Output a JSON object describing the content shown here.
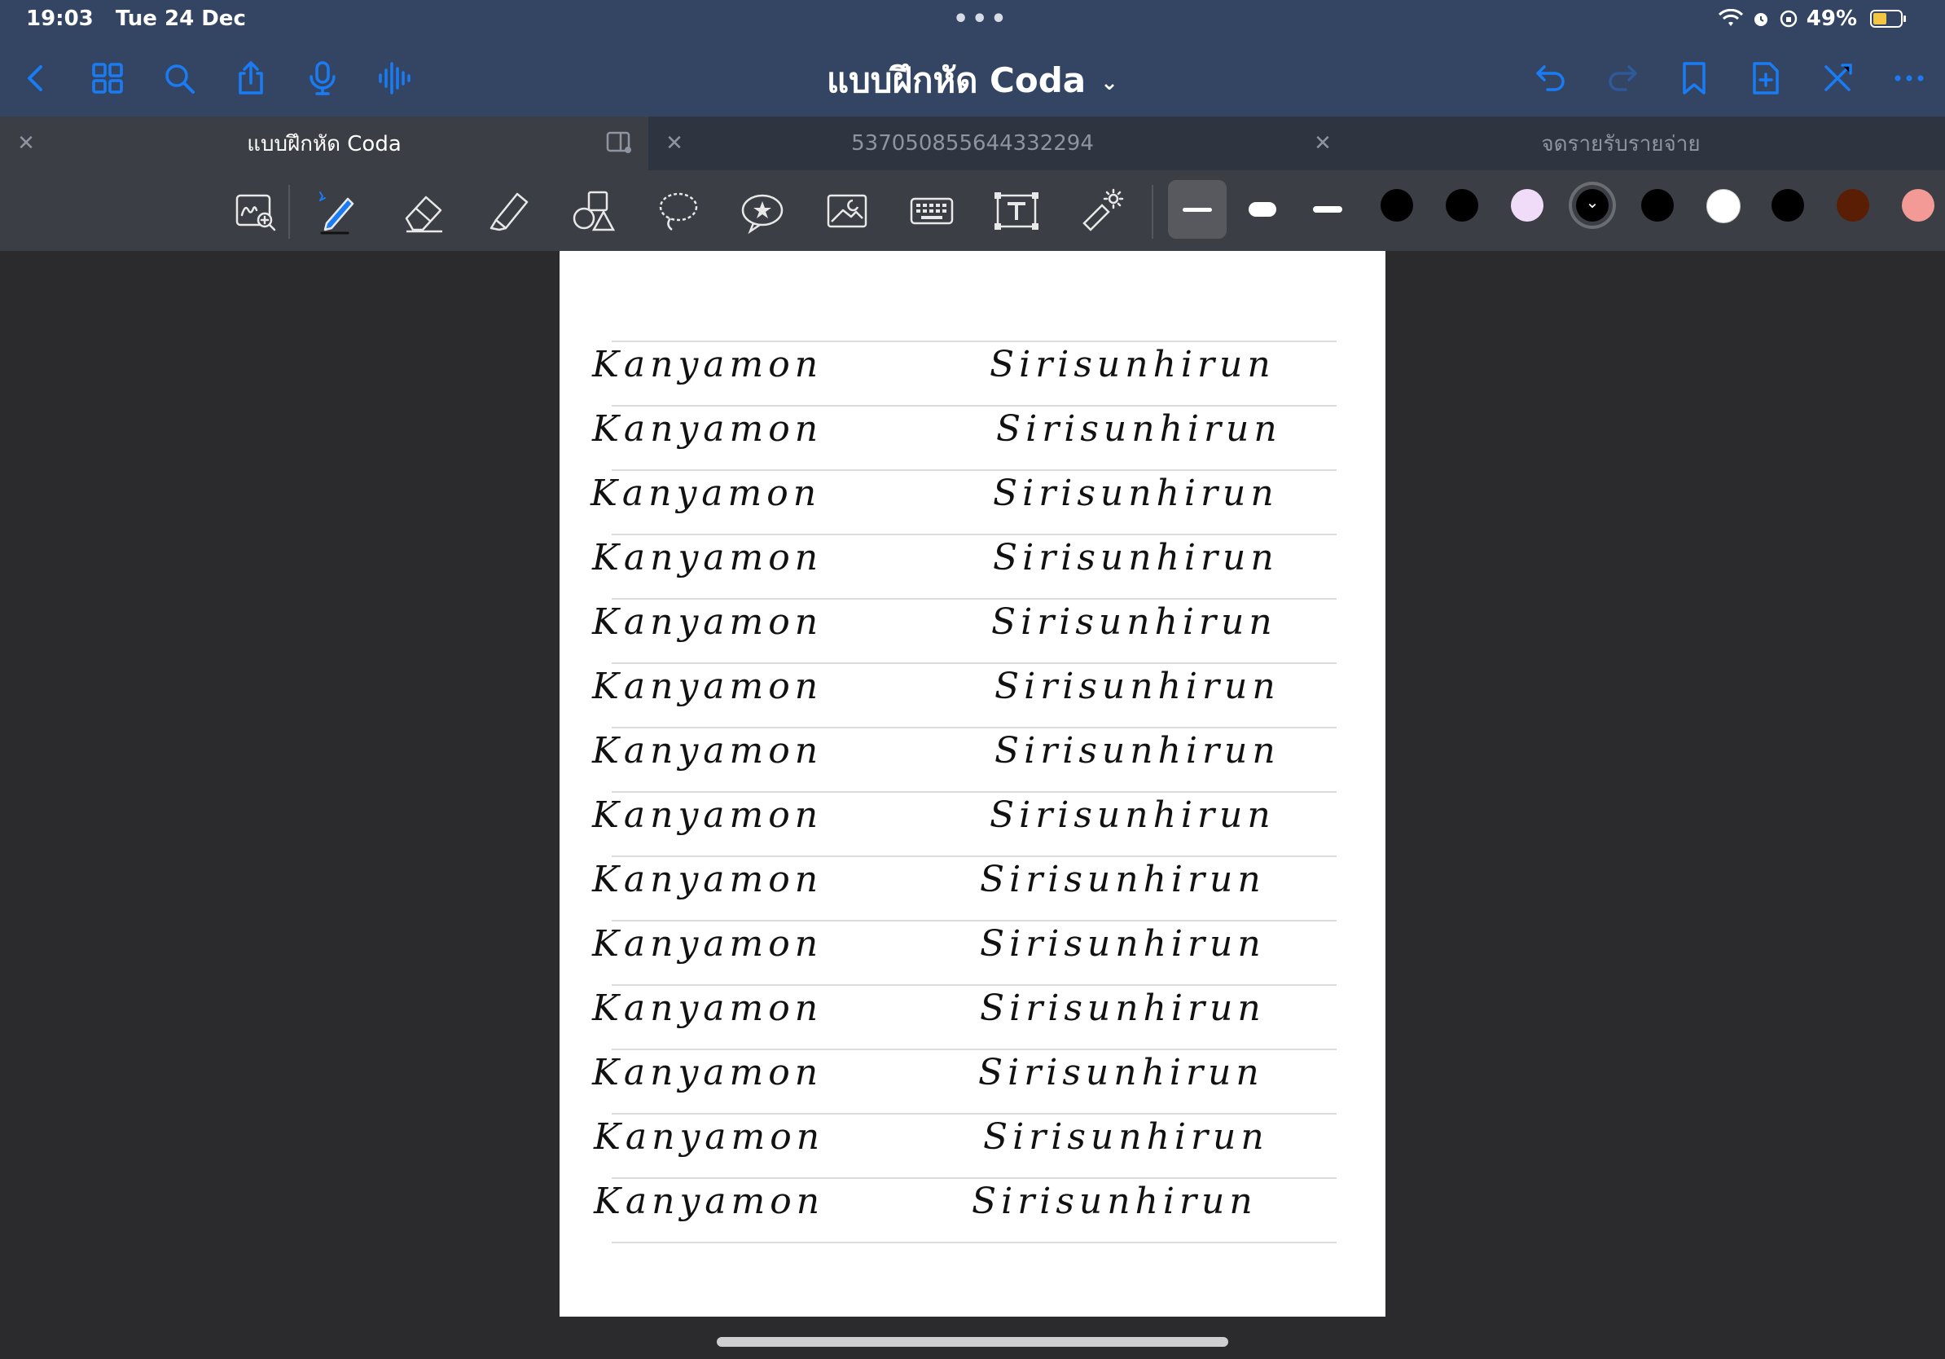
{
  "status": {
    "time": "19:03",
    "date": "Tue 24 Dec",
    "battery": "49%",
    "battery_level": 0.49
  },
  "nav": {
    "title": "แบบฝึกหัด Coda",
    "left_icons": [
      "back-chevron-icon",
      "grid-icon",
      "search-icon",
      "share-icon",
      "microphone-icon",
      "audio-waveform-icon"
    ],
    "right_icons": [
      "undo-icon",
      "redo-icon",
      "bookmark-icon",
      "add-page-icon",
      "close-x-icon",
      "more-icon"
    ]
  },
  "tabs": [
    {
      "label": "แบบฝึกหัด Coda",
      "active": true
    },
    {
      "label": "537050855644332294",
      "active": false
    },
    {
      "label": "จดรายรับรายจ่าย",
      "active": false
    }
  ],
  "toolbar": {
    "tools": [
      "zoom-handwriting-icon",
      "pen-icon",
      "eraser-icon",
      "highlighter-icon",
      "shapes-icon",
      "lasso-icon",
      "sticker-icon",
      "image-icon",
      "keyboard-icon",
      "text-box-icon",
      "laser-pointer-icon"
    ],
    "colors": {
      "accent": "#1a7cf5",
      "swatches": [
        "#000000",
        "#000000",
        "#f0dcf8",
        "#000000",
        "#000000",
        "#ffffff",
        "#000000",
        "#5a1e05",
        "#f49a96"
      ]
    }
  },
  "page": {
    "rows": [
      {
        "first": "Kanyamon",
        "last": "Sirisunhirun"
      },
      {
        "first": "Kanyamon",
        "last": "Sirisunhirun"
      },
      {
        "first": "Kanyamon",
        "last": "Sirisunhirun"
      },
      {
        "first": "Kanyamon",
        "last": "Sirisunhirun"
      },
      {
        "first": "Kanyamon",
        "last": "Sirisunhirun"
      },
      {
        "first": "Kanyamon",
        "last": "Sirisunhirun"
      },
      {
        "first": "Kanyamon",
        "last": "Sirisunhirun"
      },
      {
        "first": "Kanyamon",
        "last": "Sirisunhirun"
      },
      {
        "first": "Kanyamon",
        "last": "Sirisunhirun"
      },
      {
        "first": "Kanyamon",
        "last": "Sirisunhirun"
      },
      {
        "first": "Kanyamon",
        "last": "Sirisunhirun"
      },
      {
        "first": "Kanyamon",
        "last": "Sirisunhirun"
      },
      {
        "first": "Kanyamon",
        "last": "Sirisunhirun"
      },
      {
        "first": "Kanyamon",
        "last": "Sirisunhirun"
      }
    ]
  }
}
